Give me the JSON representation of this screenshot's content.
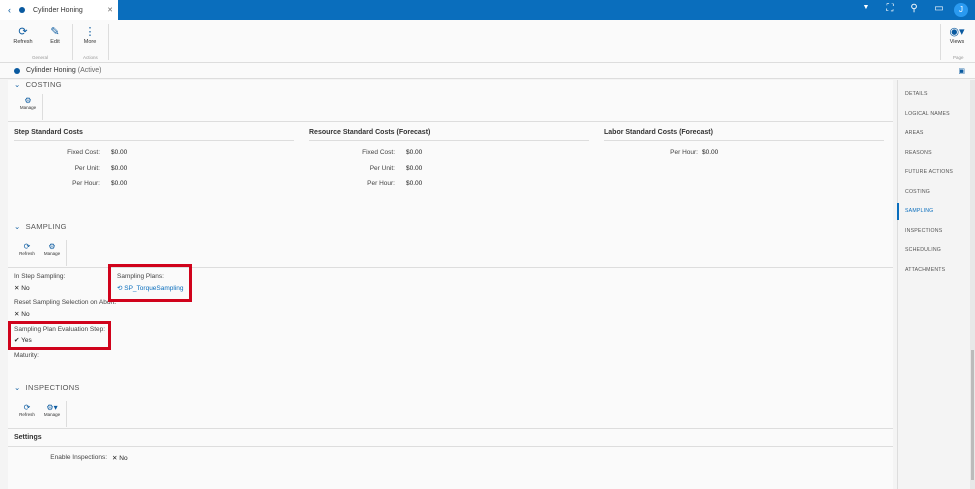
{
  "tab": {
    "title": "Cylinder Honing",
    "user_initial": "J"
  },
  "toolbar": {
    "refresh": "Refresh",
    "edit": "Edit",
    "more": "More",
    "group_general": "General",
    "group_actions": "Actions",
    "views": "Views",
    "group_page": "Page"
  },
  "header": {
    "title": "Cylinder Honing",
    "status": "(Active)"
  },
  "costing": {
    "title": "COSTING",
    "manage": "Manage",
    "step": {
      "title": "Step Standard Costs",
      "fixed_label": "Fixed Cost:",
      "fixed": "$0.00",
      "unit_label": "Per Unit:",
      "unit": "$0.00",
      "hour_label": "Per Hour:",
      "hour": "$0.00"
    },
    "resource": {
      "title": "Resource Standard Costs (Forecast)",
      "fixed_label": "Fixed Cost:",
      "fixed": "$0.00",
      "unit_label": "Per Unit:",
      "unit": "$0.00",
      "hour_label": "Per Hour:",
      "hour": "$0.00"
    },
    "labor": {
      "title": "Labor Standard Costs (Forecast)",
      "hour_label": "Per Hour:",
      "hour": "$0.00"
    }
  },
  "sampling": {
    "title": "SAMPLING",
    "refresh": "Refresh",
    "manage": "Manage",
    "in_step_label": "In Step Sampling:",
    "in_step": "No",
    "plans_label": "Sampling Plans:",
    "plan": "SP_TorqueSampling",
    "reset_label": "Reset Sampling Selection on Abort:",
    "reset": "No",
    "eval_label": "Sampling Plan Evaluation Step:",
    "eval": "Yes",
    "maturity_label": "Maturity:"
  },
  "inspections": {
    "title": "INSPECTIONS",
    "refresh": "Refresh",
    "manage": "Manage",
    "settings": "Settings",
    "enable_label": "Enable Inspections:",
    "enable": "No"
  },
  "nav": [
    "DETAILS",
    "LOGICAL NAMES",
    "AREAS",
    "REASONS",
    "FUTURE ACTIONS",
    "COSTING",
    "SAMPLING",
    "INSPECTIONS",
    "SCHEDULING",
    "ATTACHMENTS"
  ],
  "colors": {
    "brand": "#0a6ebd",
    "highlight": "#d0021b"
  }
}
